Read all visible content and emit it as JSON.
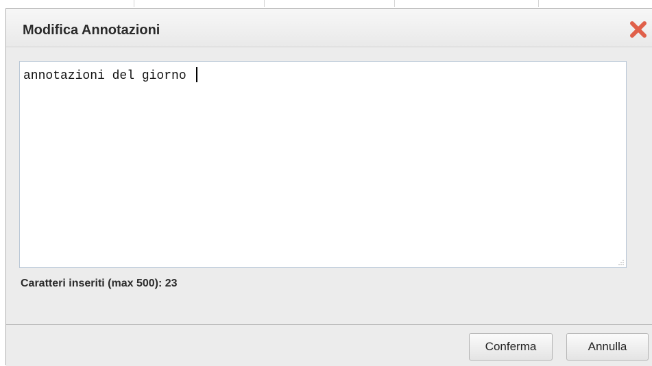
{
  "dialog": {
    "title": "Modifica Annotazioni",
    "close_icon": "close-icon",
    "close_color": "#e0604a"
  },
  "editor": {
    "value": "annotazioni del giorno ",
    "resize_icon": "resize-grip-icon"
  },
  "counter": {
    "text": "Caratteri inseriti (max 500): 23"
  },
  "buttons": {
    "confirm_label": "Conferma",
    "cancel_label": "Annulla"
  }
}
